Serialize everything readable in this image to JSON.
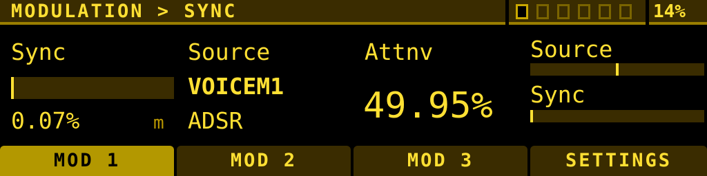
{
  "header": {
    "breadcrumb": "MODULATION > SYNC",
    "voice_count": 6,
    "active_voice": 0,
    "cpu": "14%"
  },
  "columns": [
    {
      "label": "Sync",
      "bar_fraction": 0.0007,
      "value": "0.07%",
      "tag": "m"
    },
    {
      "label": "Source",
      "line1": "VOICEM1",
      "line2": "ADSR"
    },
    {
      "label": "Attnv",
      "value": "49.95%"
    },
    {
      "source_label": "Source",
      "source_bar_fraction": 0.5,
      "sync_label": "Sync",
      "sync_bar_fraction": 0.0007
    }
  ],
  "tabs": [
    {
      "label": "MOD 1",
      "active": true
    },
    {
      "label": "MOD 2",
      "active": false
    },
    {
      "label": "MOD 3",
      "active": false
    },
    {
      "label": "SETTINGS",
      "active": false
    }
  ],
  "colors": {
    "accent": "#ffe033",
    "panel": "#3a2c00",
    "active_tab": "#b39800",
    "background": "#000000"
  }
}
